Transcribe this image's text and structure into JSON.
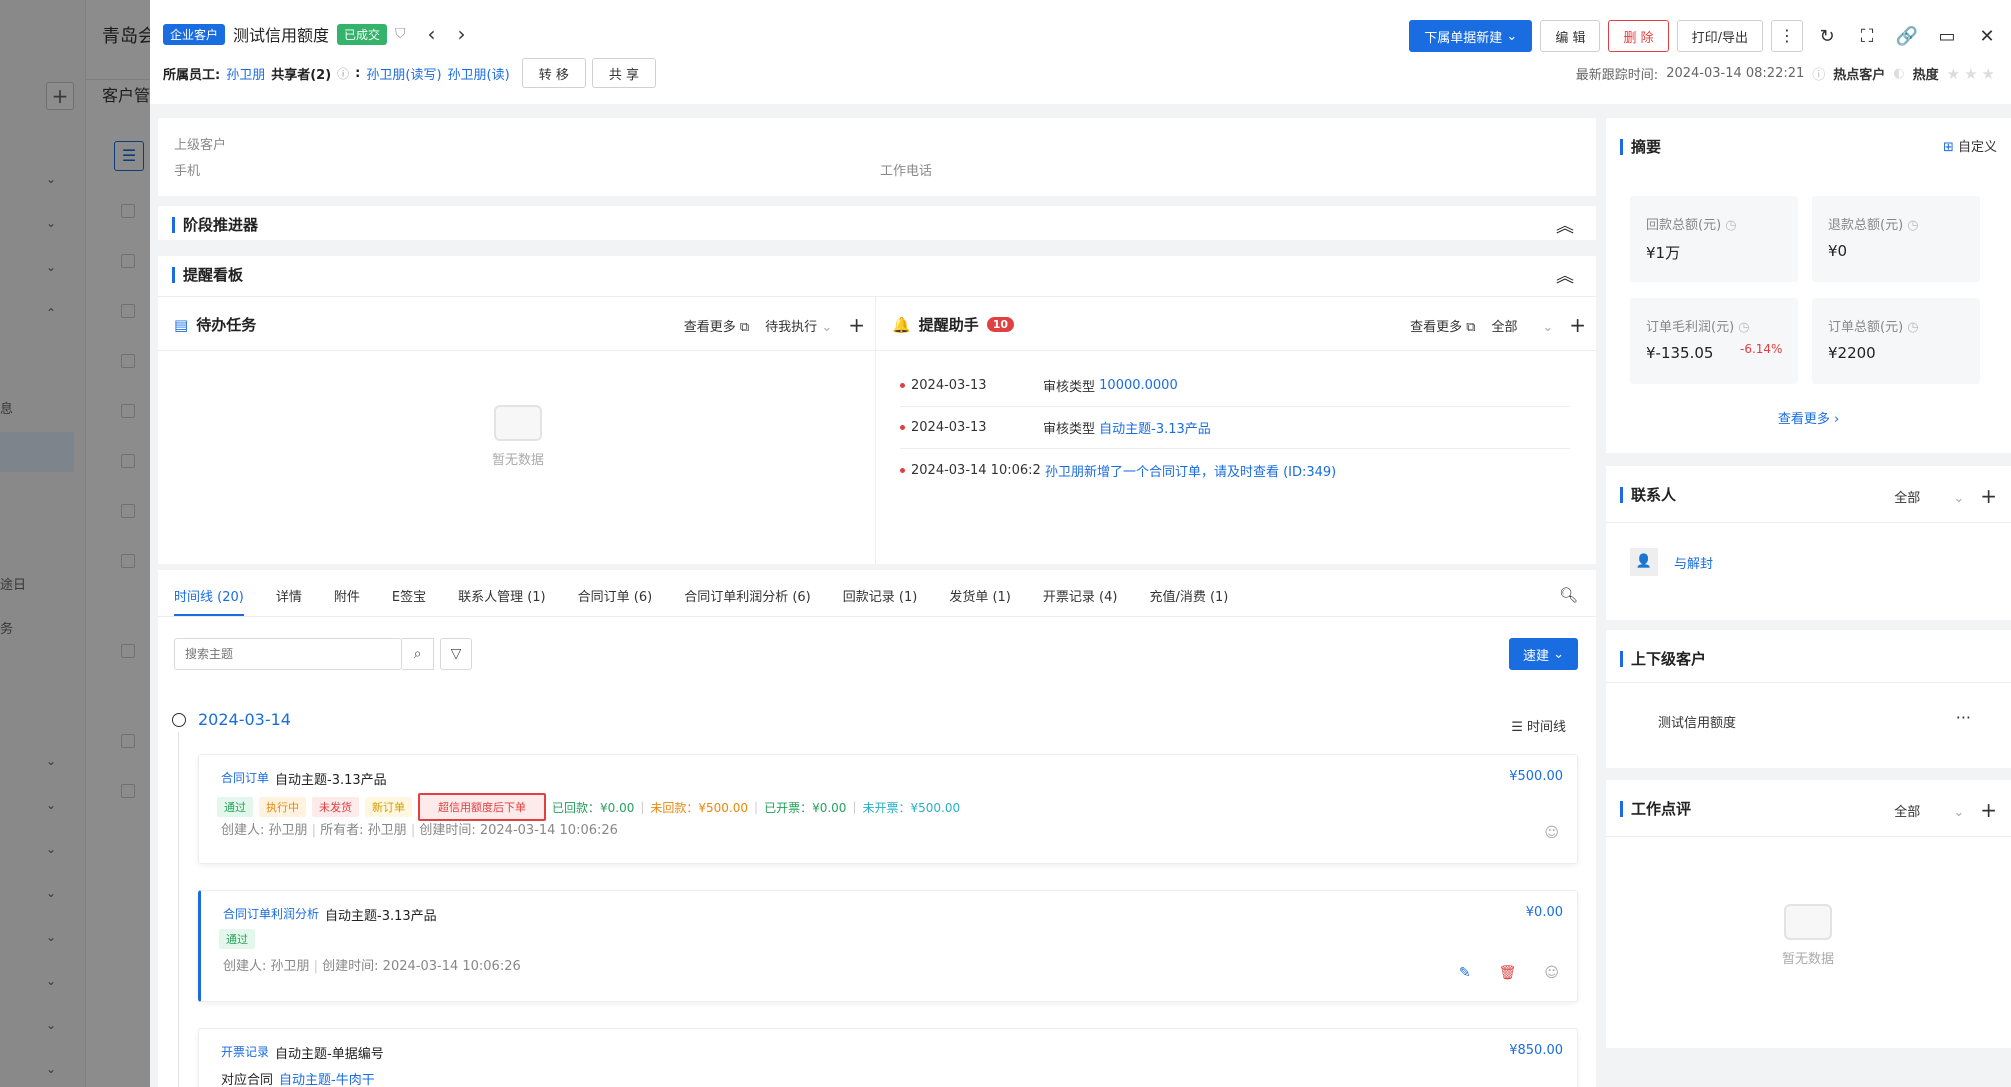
{
  "background_app": {
    "title_fragment": "青岛会",
    "tab_fragment": "客户管",
    "fragments": [
      "息",
      "途日",
      "务"
    ]
  },
  "header": {
    "customer_type_tag": "企业客户",
    "customer_name": "测试信用额度",
    "status_tag": "已成交",
    "actions": {
      "sub_new": "下属单据新建",
      "edit": "编 辑",
      "delete": "删 除",
      "print_export": "打印/导出"
    },
    "owner_label": "所属员工:",
    "owner_name": "孙卫朋",
    "sharers_label": "共享者(2)",
    "sharers_colon": ":",
    "sharer1": "孙卫朋(读写)",
    "sharer2": "孙卫朋(读)",
    "transfer": "转 移",
    "share": "共 享",
    "last_follow_label": "最新跟踪时间:",
    "last_follow_time": "2024-03-14 08:22:21",
    "hot_customer": "热点客户",
    "heat_label": "热度"
  },
  "info": {
    "parent_customer_label": "上级客户",
    "mobile_label": "手机",
    "work_phone_label": "工作电话"
  },
  "stage": {
    "title": "阶段推进器"
  },
  "reminder_board": {
    "title": "提醒看板",
    "todo": {
      "title": "待办任务",
      "view_more": "查看更多",
      "filter": "待我执行",
      "empty": "暂无数据"
    },
    "assistant": {
      "title": "提醒助手",
      "count": "10",
      "view_more": "查看更多",
      "filter": "全部",
      "items": [
        {
          "date": "2024-03-13",
          "label": "审核类型",
          "value": "10000.0000"
        },
        {
          "date": "2024-03-13",
          "label": "审核类型",
          "value": "自动主题-3.13产品"
        },
        {
          "date": "2024-03-14 10:06:2",
          "label": "",
          "value": "孙卫朋新增了一个合同订单，请及时查看 (ID:349)"
        }
      ]
    }
  },
  "timeline": {
    "tabs": [
      "时间线 (20)",
      "详情",
      "附件",
      "E签宝",
      "联系人管理 (1)",
      "合同订单 (6)",
      "合同订单利润分析 (6)",
      "回款记录 (1)",
      "发货单 (1)",
      "开票记录 (4)",
      "充值/消费 (1)"
    ],
    "search_placeholder": "搜索主题",
    "quick_create": "速建",
    "date": "2024-03-14",
    "view_label": "时间线",
    "entries": [
      {
        "type": "合同订单",
        "title": "自动主题-3.13产品",
        "amount": "¥500.00",
        "tags": [
          "通过",
          "执行中",
          "未发货",
          "新订单",
          "超信用额度后下单"
        ],
        "received": "已回款：¥0.00",
        "unreceived": "未回款：¥500.00",
        "invoiced": "已开票：¥0.00",
        "uninvoiced": "未开票：¥500.00",
        "creator": "创建人: 孙卫朋",
        "owner": "所有者: 孙卫朋",
        "created": "创建时间: 2024-03-14 10:06:26"
      },
      {
        "type": "合同订单利润分析",
        "title": "自动主题-3.13产品",
        "amount": "¥0.00",
        "tags": [
          "通过"
        ],
        "creator": "创建人: 孙卫朋",
        "created": "创建时间: 2024-03-14 10:06:26"
      },
      {
        "type": "开票记录",
        "title": "自动主题-单据编号",
        "amount": "¥850.00",
        "contract_label": "对应合同",
        "contract_value": "自动主题-牛肉干"
      }
    ]
  },
  "summary": {
    "title": "摘要",
    "customize": "自定义",
    "stats": [
      {
        "label": "回款总额(元)",
        "value": "¥1万"
      },
      {
        "label": "退款总额(元)",
        "value": "¥0"
      },
      {
        "label": "订单毛利润(元)",
        "value": "¥-135.05",
        "pct": "-6.14%"
      },
      {
        "label": "订单总额(元)",
        "value": "¥2200"
      }
    ],
    "view_more": "查看更多"
  },
  "contacts": {
    "title": "联系人",
    "filter": "全部",
    "name": "与解封"
  },
  "parent_child": {
    "title": "上下级客户",
    "name": "测试信用额度"
  },
  "work_review": {
    "title": "工作点评",
    "filter": "全部",
    "empty": "暂无数据"
  },
  "colors": {
    "primary": "#1a6de0",
    "danger": "#e24040",
    "success": "#34b36b"
  }
}
